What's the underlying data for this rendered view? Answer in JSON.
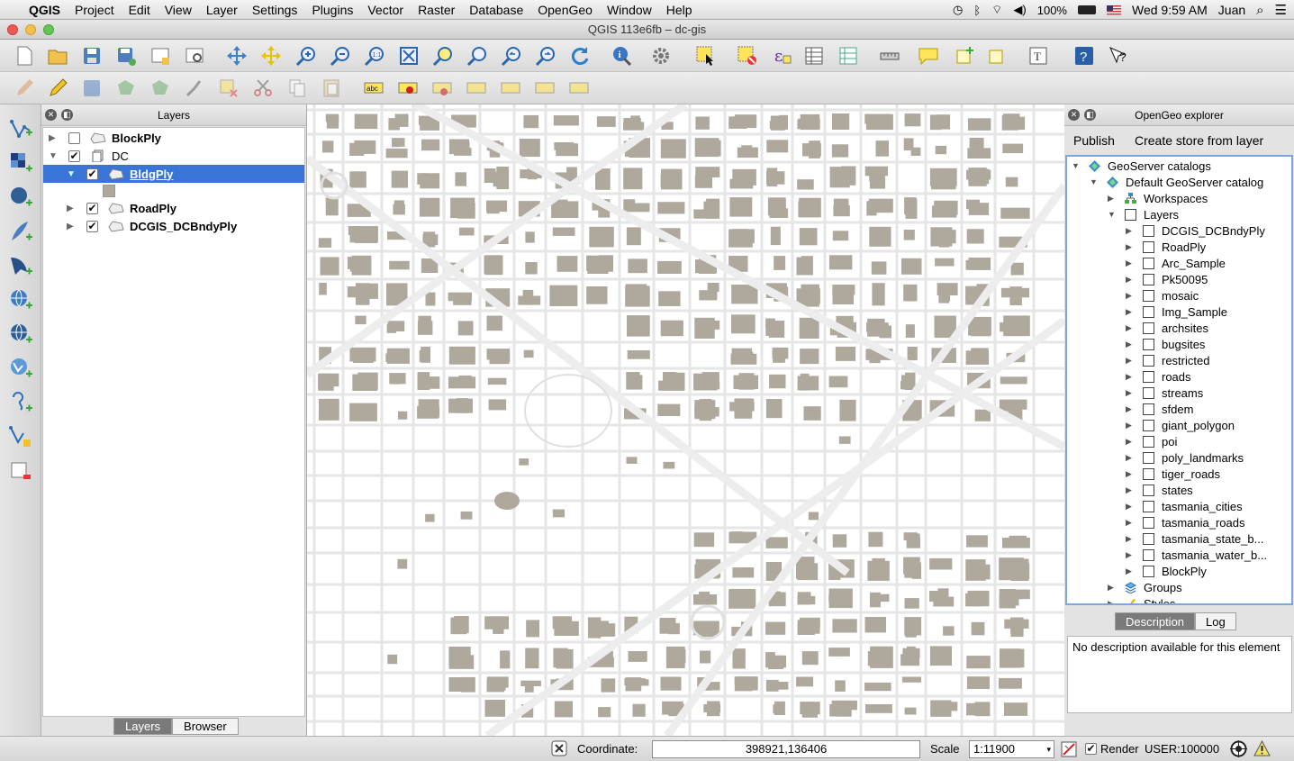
{
  "menubar": {
    "app": "QGIS",
    "items": [
      "Project",
      "Edit",
      "View",
      "Layer",
      "Settings",
      "Plugins",
      "Vector",
      "Raster",
      "Database",
      "OpenGeo",
      "Window",
      "Help"
    ],
    "battery": "100%",
    "clock": "Wed 9:59 AM",
    "user": "Juan"
  },
  "window": {
    "title": "QGIS 113e6fb – dc-gis"
  },
  "layers_panel": {
    "title": "Layers",
    "items": [
      {
        "label": "BlockPly",
        "checked": false
      },
      {
        "label": "DC",
        "checked": true
      },
      {
        "label": "BldgPly",
        "checked": true
      },
      {
        "label": "RoadPly",
        "checked": true
      },
      {
        "label": "DCGIS_DCBndyPly",
        "checked": true
      }
    ],
    "tabs": [
      "Layers",
      "Browser"
    ]
  },
  "explorer": {
    "title": "OpenGeo explorer",
    "toolbar": [
      "Publish",
      "Create store from layer"
    ],
    "tree": {
      "root": "GeoServer catalogs",
      "catalog": "Default GeoServer catalog",
      "workspaces": "Workspaces",
      "layers": "Layers",
      "layer_items": [
        "DCGIS_DCBndyPly",
        "RoadPly",
        "Arc_Sample",
        "Pk50095",
        "mosaic",
        "Img_Sample",
        "archsites",
        "bugsites",
        "restricted",
        "roads",
        "streams",
        "sfdem",
        "giant_polygon",
        "poi",
        "poly_landmarks",
        "tiger_roads",
        "states",
        "tasmania_cities",
        "tasmania_roads",
        "tasmania_state_b...",
        "tasmania_water_b...",
        "BlockPly"
      ],
      "groups": "Groups",
      "styles": "Styles"
    },
    "tabs": [
      "Description",
      "Log"
    ],
    "description": "No description available for this element"
  },
  "statusbar": {
    "coordinate_label": "Coordinate:",
    "coordinate_value": "398921,136406",
    "scale_label": "Scale",
    "scale_value": "1:11900",
    "render_label": "Render",
    "crs": "USER:100000"
  },
  "colors": {
    "building": "#aea89d",
    "road": "#e6e6e6",
    "selection": "#3875d7"
  },
  "icons": {
    "toolbar1": [
      "new-project-icon",
      "open-project-icon",
      "save-project-icon",
      "save-as-icon",
      "new-print-composer-icon",
      "composer-manager-icon",
      "pan-icon",
      "pan-to-selection-icon",
      "zoom-in-icon",
      "zoom-out-icon",
      "zoom-actual-icon",
      "zoom-full-icon",
      "zoom-to-selection-icon",
      "zoom-to-layer-icon",
      "zoom-last-icon",
      "zoom-next-icon",
      "refresh-icon",
      "identify-icon",
      "action-icon",
      "select-icon",
      "deselect-icon",
      "field-calculator-icon",
      "attribute-table-icon",
      "statistics-icon",
      "measure-icon",
      "map-tips-icon",
      "new-bookmark-icon",
      "show-bookmarks-icon",
      "text-annotation-icon",
      "help-icon",
      "whats-this-icon"
    ],
    "toolbar2": [
      "edit-pencil-icon",
      "toggle-editing-icon",
      "save-edits-icon",
      "add-feature-icon",
      "move-feature-icon",
      "node-tool-icon",
      "delete-selected-icon",
      "cut-icon",
      "copy-icon",
      "paste-icon",
      "label-icon",
      "pin-label-icon",
      "show-hide-label-icon",
      "move-label-icon",
      "rotate-label-icon",
      "change-label-icon"
    ],
    "left": [
      "add-vector-layer-icon",
      "add-raster-layer-icon",
      "add-postgis-layer-icon",
      "add-spatialite-layer-icon",
      "add-mssql-layer-icon",
      "add-wms-layer-icon",
      "add-wcs-layer-icon",
      "add-wfs-layer-icon",
      "add-delimited-text-icon",
      "new-shapefile-icon",
      "remove-layer-icon"
    ]
  }
}
